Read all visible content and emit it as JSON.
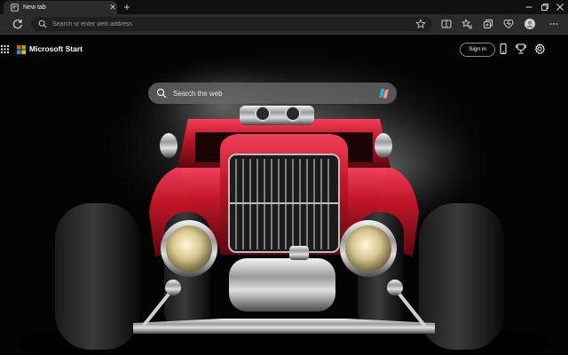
{
  "tab": {
    "title": "New tab",
    "close_glyph": "✕",
    "favicon": "newtab-page-icon"
  },
  "new_tab_glyph": "+",
  "window_controls": [
    "minimize-icon",
    "restore-icon",
    "close-icon"
  ],
  "toolbar": {
    "address_placeholder": "Search or enter web address",
    "icons": [
      "refresh-icon",
      "search-icon",
      "favorite-star-icon",
      "split-screen-icon",
      "favorites-icon",
      "collections-icon",
      "browser-essentials-icon",
      "profile-avatar-icon",
      "more-options-icon"
    ]
  },
  "newtab": {
    "brand": "Microsoft Start",
    "signin_label": "Sign in",
    "search_placeholder": "Search the web",
    "icons": [
      "apps-launcher-icon",
      "microsoft-logo-icon",
      "mobile-app-icon",
      "rewards-icon",
      "settings-gear-icon",
      "copilot-icon"
    ]
  },
  "colors": {
    "tabstrip_bg": "#0f0f0f",
    "toolbar_bg": "#2b2b2b",
    "car_red": "#c21628",
    "ms_logo": [
      "#f25022",
      "#7fba00",
      "#00a4ef",
      "#ffb900"
    ]
  },
  "background_image": "red hot rod car front view in smoke on black background"
}
